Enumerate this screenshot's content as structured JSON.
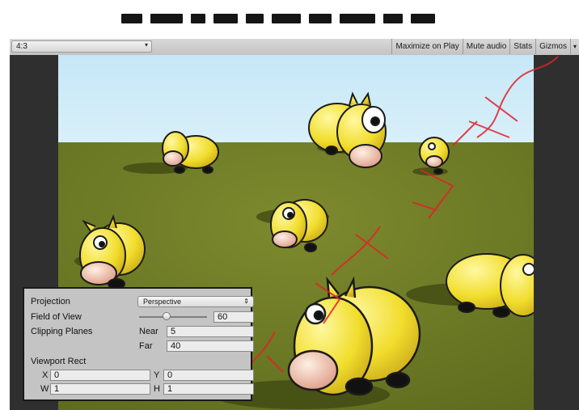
{
  "toolbar": {
    "aspect": "4:3",
    "buttons": [
      "Maximize on Play",
      "Mute audio",
      "Stats",
      "Gizmos"
    ]
  },
  "camera_preview": {
    "projection_label": "Projection",
    "projection_value": "Perspective",
    "fov_label": "Field of View",
    "fov_value": "60",
    "fov_fraction": 0.4,
    "clipping_label": "Clipping Planes",
    "near_label": "Near",
    "near_value": "5",
    "far_label": "Far",
    "far_value": "40",
    "viewport_label": "Viewport Rect",
    "x_label": "X",
    "x_value": "0",
    "y_label": "Y",
    "y_value": "0",
    "w_label": "W",
    "w_value": "1",
    "h_label": "H",
    "h_value": "1"
  },
  "watermark": {
    "text": "超人精要实"
  },
  "colors": {
    "sky": "#c9e9f7",
    "ground": "#6f7a25",
    "cow": "#f2e33a",
    "watermark": "#e0222a"
  }
}
